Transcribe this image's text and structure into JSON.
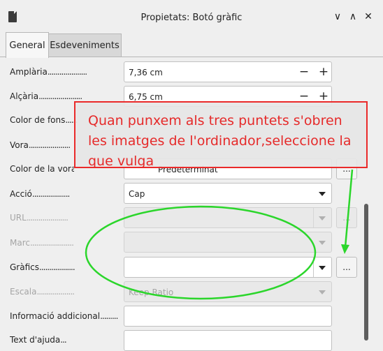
{
  "window": {
    "title": "Propietats: Botó gràfic",
    "controls": [
      "chevron-down",
      "chevron-up",
      "close"
    ]
  },
  "tabs": [
    {
      "label": "General",
      "active": true
    },
    {
      "label": "Esdeveniments",
      "active": false
    }
  ],
  "fields": {
    "amplaria": {
      "label": "Amplària",
      "dots": "....................",
      "value": "7,36 cm"
    },
    "alcaria": {
      "label": "Alçària",
      "dots": "......................",
      "value": "6,75 cm"
    },
    "color_fons": {
      "label": "Color de fons",
      "dots": "......"
    },
    "vora": {
      "label": "Vora",
      "dots": "....................."
    },
    "color_vora": {
      "label": "Color de la vora",
      "value": "Predeterminat"
    },
    "accio": {
      "label": "Acció",
      "dots": "...................",
      "value": "Cap"
    },
    "url": {
      "label": "URL",
      "dots": "....................."
    },
    "marc": {
      "label": "Marc",
      "dots": "......................"
    },
    "grafics": {
      "label": "Gràfics",
      "dots": ".................."
    },
    "escala": {
      "label": "Escala",
      "dots": "...................",
      "value": "Keep Ratio"
    },
    "informacio": {
      "label": "Informació addicional",
      "dots": "........."
    },
    "text_ajuda": {
      "label": "Text d'ajuda",
      "dots": "..."
    }
  },
  "buttons": {
    "ellipsis": "...",
    "minus": "−",
    "plus": "+"
  },
  "annotation": {
    "text": "Quan punxem als tres puntets s'obren les imatges de l'ordinador,seleccione la que vulga",
    "color": "#e62a2a",
    "ellipse_color": "#2bd62b"
  }
}
